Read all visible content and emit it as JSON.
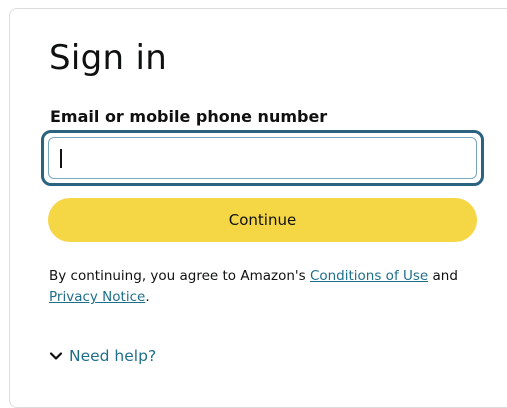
{
  "signin": {
    "title": "Sign in",
    "email_label": "Email or mobile phone number",
    "email_value": "",
    "continue_label": "Continue"
  },
  "legal": {
    "prefix": "By continuing, you agree to Amazon's ",
    "conditions_link": "Conditions of Use",
    "middle": " and ",
    "privacy_link": "Privacy Notice",
    "suffix": "."
  },
  "help": {
    "icon": "chevron-down-icon",
    "label": "Need help?"
  },
  "colors": {
    "button": "#f5d645",
    "focus_ring": "#2b6280",
    "link": "#1f6f8b"
  }
}
